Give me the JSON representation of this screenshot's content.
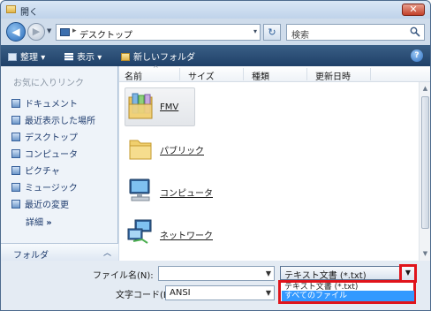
{
  "window": {
    "title": "開く",
    "close_glyph": "✕"
  },
  "nav": {
    "back_glyph": "◀",
    "forward_glyph": "▶",
    "history_glyph": "▼",
    "address": {
      "separator": "▸",
      "location": "デスクトップ",
      "dropdown_glyph": "▾"
    },
    "refresh_glyph": "↻",
    "search_placeholder": "検索"
  },
  "toolbar": {
    "organize": "整理",
    "views": "表示",
    "new_folder": "新しいフォルダ",
    "dropdown_glyph": "▾",
    "help": "?"
  },
  "sidebar": {
    "favorites_header": "お気に入りリンク",
    "items": [
      {
        "label": "ドキュメント",
        "icon": "documents-icon"
      },
      {
        "label": "最近表示した場所",
        "icon": "recent-places-icon"
      },
      {
        "label": "デスクトップ",
        "icon": "desktop-icon"
      },
      {
        "label": "コンピュータ",
        "icon": "computer-icon"
      },
      {
        "label": "ピクチャ",
        "icon": "pictures-icon"
      },
      {
        "label": "ミュージック",
        "icon": "music-icon"
      },
      {
        "label": "最近の変更",
        "icon": "recently-changed-icon"
      }
    ],
    "more": "詳細",
    "more_glyph": "»",
    "folders_label": "フォルダ",
    "folders_glyph": "︿"
  },
  "file_list": {
    "columns": [
      "名前",
      "サイズ",
      "種類",
      "更新日時"
    ],
    "sort_glyph": "^",
    "scroll_up_glyph": "▲",
    "scroll_down_glyph": "▼",
    "items": [
      {
        "name": "FMV",
        "icon": "folder-documents-icon",
        "selected": true
      },
      {
        "name": "パブリック",
        "icon": "folder-icon"
      },
      {
        "name": "コンピュータ",
        "icon": "computer-icon"
      },
      {
        "name": "ネットワーク",
        "icon": "network-icon"
      }
    ]
  },
  "bottom": {
    "filename_label": "ファイル名(N):",
    "filename_value": "",
    "encoding_label": "文字コード(E):",
    "encoding_value": "ANSI",
    "filetype_selected": "テキスト文書 (*.txt)",
    "dropdown_glyph": "▼",
    "filetype_options": [
      "テキスト文書 (*.txt)",
      "すべてのファイル"
    ],
    "highlight_color": "#e0141b"
  }
}
